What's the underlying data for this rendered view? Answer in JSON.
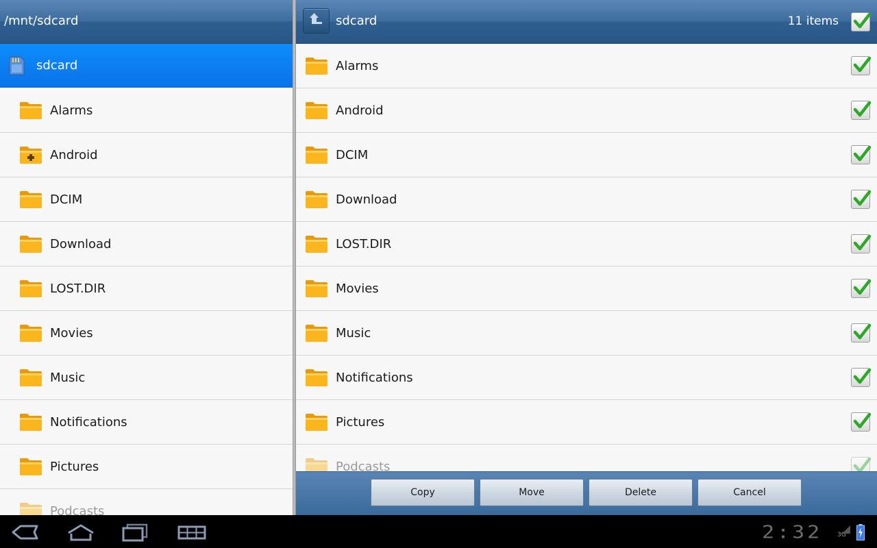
{
  "left_pane": {
    "path": "/mnt/sdcard",
    "root_label": "sdcard",
    "folders": [
      {
        "name": "Alarms",
        "icon": "folder-icon"
      },
      {
        "name": "Android",
        "icon": "folder-plus-icon"
      },
      {
        "name": "DCIM",
        "icon": "folder-icon"
      },
      {
        "name": "Download",
        "icon": "folder-icon"
      },
      {
        "name": "LOST.DIR",
        "icon": "folder-icon"
      },
      {
        "name": "Movies",
        "icon": "folder-icon"
      },
      {
        "name": "Music",
        "icon": "folder-icon"
      },
      {
        "name": "Notifications",
        "icon": "folder-icon"
      },
      {
        "name": "Pictures",
        "icon": "folder-icon"
      },
      {
        "name": "Podcasts",
        "icon": "folder-icon"
      }
    ]
  },
  "right_pane": {
    "folder_name": "sdcard",
    "items_count": "11 items",
    "select_all_checked": true,
    "files": [
      {
        "name": "Alarms",
        "checked": true
      },
      {
        "name": "Android",
        "checked": true
      },
      {
        "name": "DCIM",
        "checked": true
      },
      {
        "name": "Download",
        "checked": true
      },
      {
        "name": "LOST.DIR",
        "checked": true
      },
      {
        "name": "Movies",
        "checked": true
      },
      {
        "name": "Music",
        "checked": true
      },
      {
        "name": "Notifications",
        "checked": true
      },
      {
        "name": "Pictures",
        "checked": true
      },
      {
        "name": "Podcasts",
        "checked": true
      }
    ]
  },
  "actions": {
    "copy": "Copy",
    "move": "Move",
    "delete": "Delete",
    "cancel": "Cancel"
  },
  "system_bar": {
    "clock": "2:32",
    "network": "3G"
  },
  "colors": {
    "header_blue": "#3d6d9f",
    "selection_blue": "#0a72ea",
    "folder_orange": "#f7a813",
    "check_green": "#2fa82a"
  }
}
